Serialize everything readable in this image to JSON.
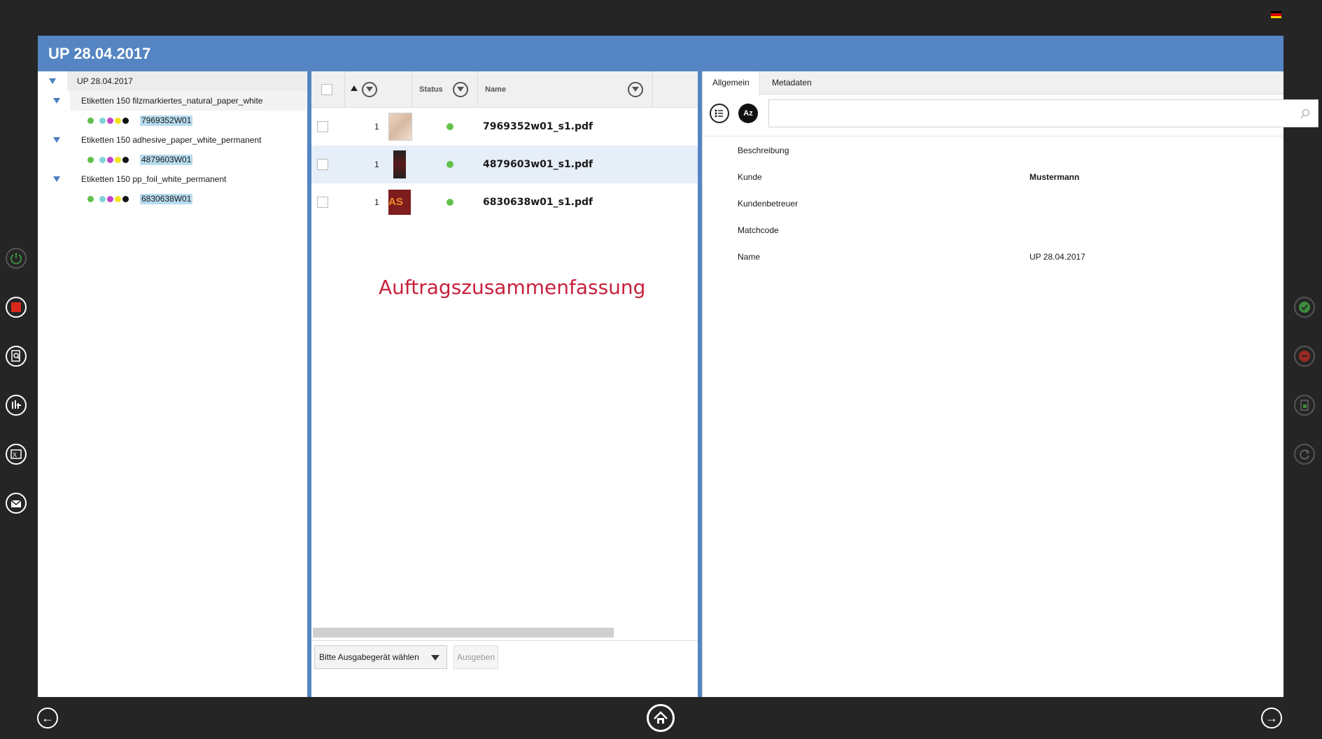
{
  "colors": {
    "title_bar": "#5585c2",
    "status_ok": "#62c14b",
    "summary": "#c8203c",
    "ink": [
      "#62c14b",
      "#7fd3d8",
      "#c143c9",
      "#f2e21a",
      "#111111"
    ]
  },
  "window": {
    "title": "UP 28.04.2017"
  },
  "tree": {
    "root": "UP 28.04.2017",
    "groups": [
      {
        "label": "Etiketten 150 filzmarkiertes_natural_paper_white",
        "job": "7969352W01"
      },
      {
        "label": "Etiketten 150 adhesive_paper_white_permanent",
        "job": "4879603W01"
      },
      {
        "label": "Etiketten 150 pp_foil_white_permanent",
        "job": "6830638W01"
      }
    ]
  },
  "grid": {
    "headers": {
      "status": "Status",
      "name": "Name"
    },
    "rows": [
      {
        "count": "1",
        "name": "7969352w01_s1.pdf"
      },
      {
        "count": "1",
        "name": "4879603w01_s1.pdf"
      },
      {
        "count": "1",
        "name": "6830638w01_s1.pdf"
      }
    ],
    "thumb3_text": "AS"
  },
  "summary_label": "Auftragszusammenfassung",
  "output": {
    "device_placeholder": "Bitte Ausgabegerät wählen",
    "button": "Ausgeben"
  },
  "details": {
    "tabs": [
      "Allgemein",
      "Metadaten"
    ],
    "az_label": "Az",
    "properties": [
      {
        "label": "Beschreibung",
        "value": ""
      },
      {
        "label": "Kunde",
        "value": "Mustermann"
      },
      {
        "label": "Kundenbetreuer",
        "value": ""
      },
      {
        "label": "Matchcode",
        "value": ""
      },
      {
        "label": "Name",
        "value": "UP 28.04.2017"
      }
    ]
  },
  "icons": {
    "left_sidebar": [
      "power-icon",
      "stop-icon",
      "preview-icon",
      "equalizer-icon",
      "excel-icon",
      "mail-icon"
    ],
    "right_sidebar": [
      "confirm-icon",
      "cancel-icon",
      "document-icon",
      "refresh-icon"
    ],
    "bottom": [
      "back-arrow-icon",
      "home-icon",
      "forward-arrow-icon"
    ]
  }
}
